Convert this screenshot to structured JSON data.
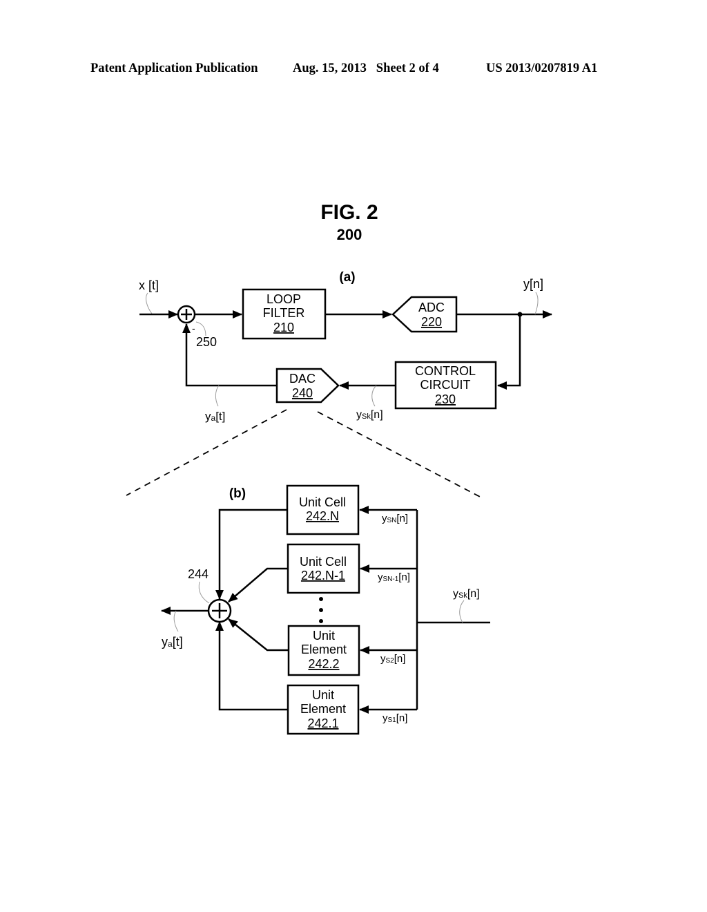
{
  "header": {
    "publication": "Patent Application Publication",
    "date_sheet": "Aug. 15, 2013   Sheet 2 of 4",
    "number": "US 2013/0207819 A1"
  },
  "figure": {
    "title": "FIG. 2",
    "ref": "200"
  },
  "part_a": {
    "label": "(a)",
    "input_signal": "x [t]",
    "output_signal": "y[n]",
    "summer": {
      "ref": "250",
      "minus": "-"
    },
    "loop_filter": {
      "line1": "LOOP",
      "line2": "FILTER",
      "ref": "210"
    },
    "adc": {
      "line1": "ADC",
      "ref": "220"
    },
    "control_circuit": {
      "line1": "CONTROL",
      "line2": "CIRCUIT",
      "ref": "230"
    },
    "dac": {
      "line1": "DAC",
      "ref": "240"
    },
    "dac_output": {
      "base": "y",
      "sub": "a",
      "rest": "[t]"
    },
    "dac_input": {
      "base": "y",
      "sub": "Sk",
      "rest": "[n]"
    }
  },
  "part_b": {
    "label": "(b)",
    "summer_ref": "244",
    "output_signal": {
      "base": "y",
      "sub": "a",
      "rest": "[t]"
    },
    "input_signal": {
      "base": "y",
      "sub": "Sk",
      "rest": "[n]"
    },
    "ellipsis": "⋮",
    "units": [
      {
        "line1": "Unit Cell",
        "line2": "",
        "ref": "242.N",
        "signal": {
          "base": "y",
          "sub": "SN",
          "rest": "[n]"
        }
      },
      {
        "line1": "Unit Cell",
        "line2": "",
        "ref": "242.N-1",
        "signal": {
          "base": "y",
          "sub": "SN-1",
          "rest": "[n]"
        }
      },
      {
        "line1": "Unit",
        "line2": "Element",
        "ref": "242.2",
        "signal": {
          "base": "y",
          "sub": "S2",
          "rest": "[n]"
        }
      },
      {
        "line1": "Unit",
        "line2": "Element",
        "ref": "242.1",
        "signal": {
          "base": "y",
          "sub": "S1",
          "rest": "[n]"
        }
      }
    ]
  }
}
